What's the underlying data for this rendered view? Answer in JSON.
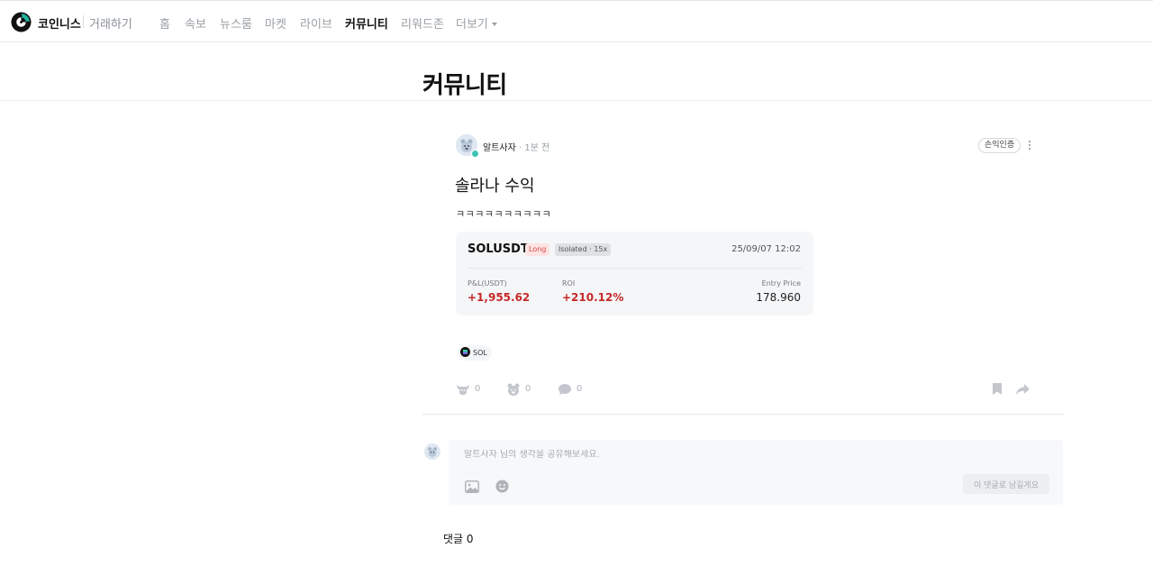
{
  "nav": {
    "brand": "코인니스",
    "trade": "거래하기",
    "items": [
      {
        "label": "홈"
      },
      {
        "label": "속보"
      },
      {
        "label": "뉴스룸"
      },
      {
        "label": "마켓"
      },
      {
        "label": "라이브"
      },
      {
        "label": "커뮤니티",
        "active": true
      },
      {
        "label": "리워드존"
      },
      {
        "label": "더보기"
      }
    ]
  },
  "page": {
    "title": "커뮤니티"
  },
  "post": {
    "author": "알트사자",
    "time": "· 1분 전",
    "tag": "손익인증",
    "title": "솔라나 수익",
    "body": "ㅋㅋㅋㅋㅋㅋㅋㅋㅋㅋ",
    "coin_tag": "SOL"
  },
  "trade": {
    "symbol": "SOLUSDT",
    "side": "Long",
    "margin": "Isolated · 15x",
    "date": "25/09/07 12:02",
    "pnl_label": "P&L(USDT)",
    "pnl_value": "+1,955.62",
    "roi_label": "ROI",
    "roi_value": "+210.12%",
    "entry_label": "Entry Price",
    "entry_value": "178.960"
  },
  "reactions": {
    "bull": "0",
    "bear": "0",
    "comments": "0"
  },
  "composer": {
    "placeholder": "알트사자 님의 생각을 공유해보세요.",
    "submit": "이 댓글로 남길게요"
  },
  "comments": {
    "header": "댓글 0"
  },
  "colors": {
    "positive": "#c62828",
    "long_badge_bg": "#fde3e3",
    "card_bg": "#f5f6f8",
    "verified_badge": "#3cc4b4"
  },
  "icons": [
    "coinness-logo",
    "chevron-down-icon",
    "kebab-icon",
    "bull-icon",
    "bear-icon",
    "comment-icon",
    "bookmark-icon",
    "share-icon",
    "image-icon",
    "emoji-icon",
    "solana-icon"
  ]
}
